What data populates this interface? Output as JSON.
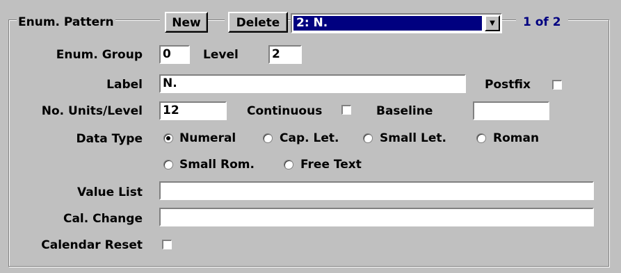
{
  "group": {
    "title": "Enum. Pattern"
  },
  "toolbar": {
    "new_label": "New",
    "delete_label": "Delete"
  },
  "pattern_select": {
    "value": "2: N."
  },
  "record_counter": "1 of 2",
  "fields": {
    "enum_group": {
      "label": "Enum. Group",
      "value": "0"
    },
    "level": {
      "label": "Level",
      "value": "2"
    },
    "label": {
      "label": "Label",
      "value": "N."
    },
    "postfix": {
      "label": "Postfix",
      "checked": false
    },
    "units_per_level": {
      "label": "No. Units/Level",
      "value": "12"
    },
    "continuous": {
      "label": "Continuous",
      "checked": false
    },
    "baseline": {
      "label": "Baseline",
      "value": ""
    },
    "data_type": {
      "label": "Data Type",
      "selected": "Numeral",
      "options": [
        "Numeral",
        "Cap. Let.",
        "Small Let.",
        "Roman",
        "Small Rom.",
        "Free Text"
      ]
    },
    "value_list": {
      "label": "Value List",
      "value": ""
    },
    "cal_change": {
      "label": "Cal. Change",
      "value": ""
    },
    "calendar_reset": {
      "label": "Calendar Reset",
      "checked": false
    }
  }
}
